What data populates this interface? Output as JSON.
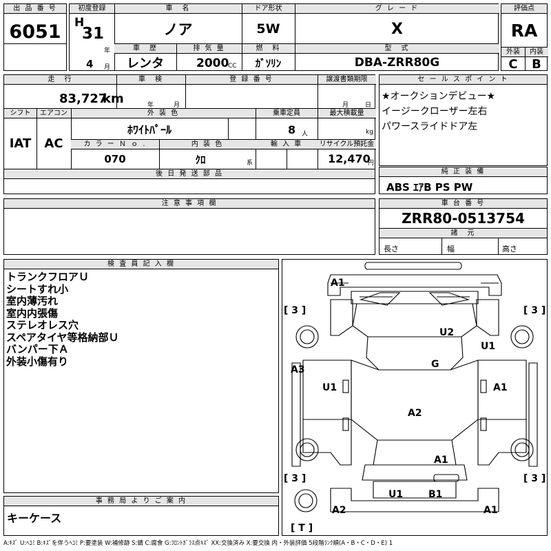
{
  "header": {
    "lot_no": {
      "label": "出 品 番 号",
      "value": "6051"
    },
    "first_reg": {
      "label": "初度登録",
      "era": "H",
      "year": "31",
      "year_unit": "年",
      "month": "4",
      "month_unit": "月"
    },
    "car_name": {
      "label": "車　名",
      "value": "ノア"
    },
    "door": {
      "label": "ドア形状",
      "value": "5W"
    },
    "grade": {
      "label": "グ レ ー ド",
      "value": "X"
    },
    "history": {
      "label": "車　歴",
      "value": "レンタ"
    },
    "displacement": {
      "label": "排 気 量",
      "value": "2000",
      "unit": "CC"
    },
    "fuel": {
      "label": "燃　料",
      "value": "ｶﾞｿﾘﾝ"
    },
    "model": {
      "label": "型　式",
      "value": "DBA-ZRR80G"
    },
    "score": {
      "label": "評価点",
      "value": "RA"
    },
    "exterior": {
      "label": "外装",
      "value": "C"
    },
    "interior": {
      "label": "内装",
      "value": "B"
    }
  },
  "specs": {
    "mileage": {
      "label": "走　行",
      "value": "83,727",
      "unit": "km"
    },
    "inspection": {
      "label": "車　検",
      "year_unit": "年",
      "month_unit": "月"
    },
    "registration": {
      "label": "登 録 番 号"
    },
    "transfer_deadline": {
      "label": "譲渡書類期限",
      "month_unit": "月",
      "day_unit": "日"
    },
    "shift": {
      "label": "シフト",
      "value": "IAT"
    },
    "ac": {
      "label": "エアコン",
      "value": "AC"
    },
    "exterior_color": {
      "label": "外 装 色",
      "value": "ﾎﾜｲﾄﾊﾟｰﾙ"
    },
    "capacity": {
      "label": "乗車定員",
      "value": "8",
      "unit": "人"
    },
    "max_load": {
      "label": "最大積載量",
      "unit": "kg"
    },
    "color_no": {
      "label": "カ ラ ー Ｎ ｏ .",
      "value": "070"
    },
    "interior_color": {
      "label": "内 装 色",
      "value": "ｸﾛ",
      "unit": "系"
    },
    "import": {
      "label": "輸 入 車"
    },
    "recycle": {
      "label": "リサイクル預託金",
      "value": "12,470",
      "unit": "円"
    },
    "later_parts": {
      "label": "後 日 発 送 部 品"
    }
  },
  "sales_points": {
    "label": "セ ー ル ス ポ イ ン ト",
    "lines": [
      "★オークションデビュー★",
      "イージークローザー左右",
      "パワースライドドア左"
    ]
  },
  "equipment": {
    "label": "純 正 装 備",
    "value": "ABS ｴｱB PS PW"
  },
  "notes": {
    "label": "注 意 事 項 欄"
  },
  "chassis": {
    "label": "車 台 番 号",
    "value": "ZRR80-0513754"
  },
  "dimensions": {
    "label": "諸　元",
    "length": "長さ",
    "width": "幅",
    "height": "高さ"
  },
  "inspector": {
    "label": "検 査 員 記 入 欄",
    "lines": [
      "トランクフロアＵ",
      "シートすれ小",
      "室内薄汚れ",
      "室内内張傷",
      "ステレオレス穴",
      "スペアタイヤ等格納部Ｕ",
      "バンパー下Ａ",
      "外装小傷有り"
    ]
  },
  "office": {
    "label": "事 務 局 よ り ご 案 内",
    "value": "キーケース"
  },
  "diagram": {
    "marks": {
      "a1_top": "A1",
      "u2": "U2",
      "u1_right_top": "U1",
      "g": "G",
      "a3_left": "A3",
      "u1_left": "U1",
      "a1_right": "A1",
      "a2_center": "A2",
      "a1_lower": "A1",
      "u1_bottom": "U1",
      "b1_bottom": "B1",
      "a2_bottom": "A2",
      "a1_bottom": "A1"
    },
    "tires": {
      "front_left": "[ 3 ]",
      "front_right": "[ 3 ]",
      "rear_left": "[ 3 ]",
      "rear_right": "[ 3 ]",
      "spare": "[ T ]"
    }
  },
  "legend": "A:ｷｽﾞ U:ﾍｺﾐ B:ｷｽﾞを伴うﾍｺﾐ P:要塗装 W:補修跡 S:錆 C:腐食 G:ﾌﾛﾝﾄｶﾞﾗｽ点ｷｽﾞ XX:交換済み X:要交換 内・外装評価 5段階ﾗﾝｸ順(A・B・C・D・E) 1"
}
